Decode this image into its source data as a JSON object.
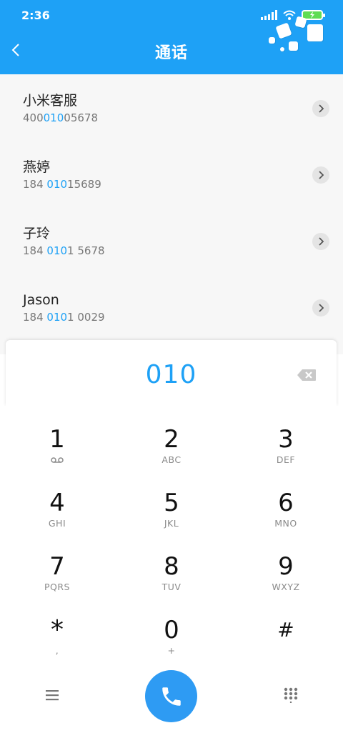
{
  "status_bar": {
    "time": "2:36"
  },
  "header": {
    "title": "通话",
    "back_icon": "chevron-left-icon",
    "decoration": "cubes-illustration"
  },
  "contacts": [
    {
      "name": "小米客服",
      "number_parts": [
        "400",
        "010",
        "05678"
      ]
    },
    {
      "name": "燕婷",
      "number_parts": [
        "184 ",
        "010",
        "15689"
      ]
    },
    {
      "name": "子玲",
      "number_parts": [
        "184 ",
        "010",
        "1 5678"
      ]
    },
    {
      "name": "Jason",
      "number_parts": [
        "184 ",
        "010",
        "1 0029"
      ]
    }
  ],
  "dialer": {
    "input_value": "010",
    "backspace_icon": "backspace-icon"
  },
  "keypad": {
    "keys": [
      {
        "digit": "1",
        "letters": ""
      },
      {
        "digit": "2",
        "letters": "ABC"
      },
      {
        "digit": "3",
        "letters": "DEF"
      },
      {
        "digit": "4",
        "letters": "GHI"
      },
      {
        "digit": "5",
        "letters": "JKL"
      },
      {
        "digit": "6",
        "letters": "MNO"
      },
      {
        "digit": "7",
        "letters": "PQRS"
      },
      {
        "digit": "8",
        "letters": "TUV"
      },
      {
        "digit": "9",
        "letters": "WXYZ"
      },
      {
        "digit": "*",
        "letters": ","
      },
      {
        "digit": "0",
        "letters": "+"
      },
      {
        "digit": "#",
        "letters": ""
      }
    ]
  },
  "bottom_bar": {
    "menu_icon": "menu-icon",
    "call_icon": "phone-icon",
    "dialpad_icon": "dialpad-icon"
  },
  "colors": {
    "accent": "#1ea1f6",
    "call_button": "#2e9bf3",
    "battery_fill": "#5fdc54"
  }
}
